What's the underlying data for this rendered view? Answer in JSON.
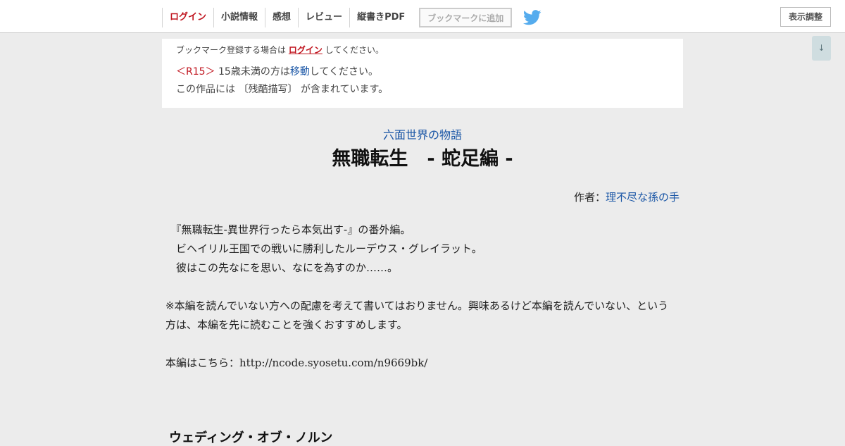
{
  "nav": {
    "items": [
      "ログイン",
      "小説情報",
      "感想",
      "レビュー",
      "縦書きPDF"
    ],
    "bookmark": "ブックマークに追加",
    "display_settings": "表示調整",
    "scroll_label": "↓"
  },
  "notice": {
    "bookmark_prefix": "ブックマーク登録する場合は",
    "bookmark_link": "ログイン",
    "bookmark_suffix": "してください。",
    "r15_tag": "＜R15＞",
    "age_prefix": "15歳未満の方は",
    "age_link": "移動",
    "age_suffix": "してください。",
    "content_warning": "この作品には 〔残酷描写〕 が含まれています。"
  },
  "novel": {
    "series": "六面世界の物語",
    "title": "無職転生　- 蛇足編 -",
    "author_label": "作者：",
    "author_name": "理不尽な孫の手",
    "synopsis": [
      "　『無職転生-異世界行ったら本気出す-』の番外編。",
      "　ビヘイリル王国での戦いに勝利したルーデウス・グレイラット。",
      "　彼はこの先なにを思い、なにを為すのか……。"
    ],
    "note": [
      "※本編を読んでいない方への配慮を考えて書いてはおりません。興味あるけど本編を読んでいない、という",
      "方は、本編を先に読むことを強くおすすめします。"
    ],
    "link_prefix": "本編はこちら：",
    "link_url": "http://ncode.syosetu.com/n9669bk/"
  },
  "chapter": {
    "title": "ウェディング・オブ・ノルン"
  },
  "colors": {
    "accent_red": "#c0141e",
    "link_blue": "#1a56a6",
    "twitter_blue": "#55acee"
  }
}
